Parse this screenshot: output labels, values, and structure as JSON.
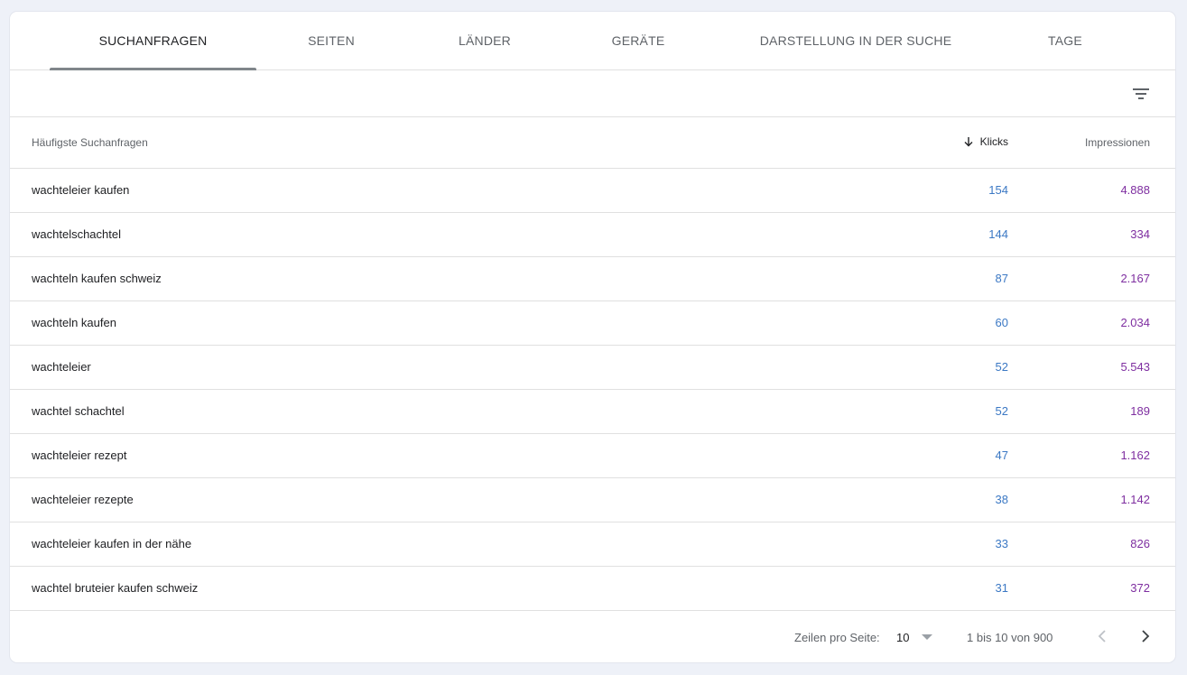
{
  "tabs": [
    {
      "label": "SUCHANFRAGEN",
      "active": true
    },
    {
      "label": "SEITEN",
      "active": false
    },
    {
      "label": "LÄNDER",
      "active": false
    },
    {
      "label": "GERÄTE",
      "active": false
    },
    {
      "label": "DARSTELLUNG IN DER SUCHE",
      "active": false
    },
    {
      "label": "TAGE",
      "active": false
    }
  ],
  "toolbar": {
    "filter_icon": "filter-list-icon"
  },
  "table": {
    "headers": {
      "query": "Häufigste Suchanfragen",
      "clicks": "Klicks",
      "impressions": "Impressionen",
      "sort_icon": "arrow-down-icon"
    },
    "rows": [
      {
        "query": "wachteleier kaufen",
        "clicks": "154",
        "impressions": "4.888"
      },
      {
        "query": "wachtelschachtel",
        "clicks": "144",
        "impressions": "334"
      },
      {
        "query": "wachteln kaufen schweiz",
        "clicks": "87",
        "impressions": "2.167"
      },
      {
        "query": "wachteln kaufen",
        "clicks": "60",
        "impressions": "2.034"
      },
      {
        "query": "wachteleier",
        "clicks": "52",
        "impressions": "5.543"
      },
      {
        "query": "wachtel schachtel",
        "clicks": "52",
        "impressions": "189"
      },
      {
        "query": "wachteleier rezept",
        "clicks": "47",
        "impressions": "1.162"
      },
      {
        "query": "wachteleier rezepte",
        "clicks": "38",
        "impressions": "1.142"
      },
      {
        "query": "wachteleier kaufen in der nähe",
        "clicks": "33",
        "impressions": "826"
      },
      {
        "query": "wachtel bruteier kaufen schweiz",
        "clicks": "31",
        "impressions": "372"
      }
    ]
  },
  "pagination": {
    "rows_per_page_label": "Zeilen pro Seite:",
    "rows_per_page_value": "10",
    "range_text": "1 bis 10 von 900",
    "prev_icon": "chevron-left-icon",
    "next_icon": "chevron-right-icon"
  },
  "colors": {
    "clicks": "#3b78c4",
    "impressions": "#7e2ea0",
    "background": "#eef1f8"
  }
}
